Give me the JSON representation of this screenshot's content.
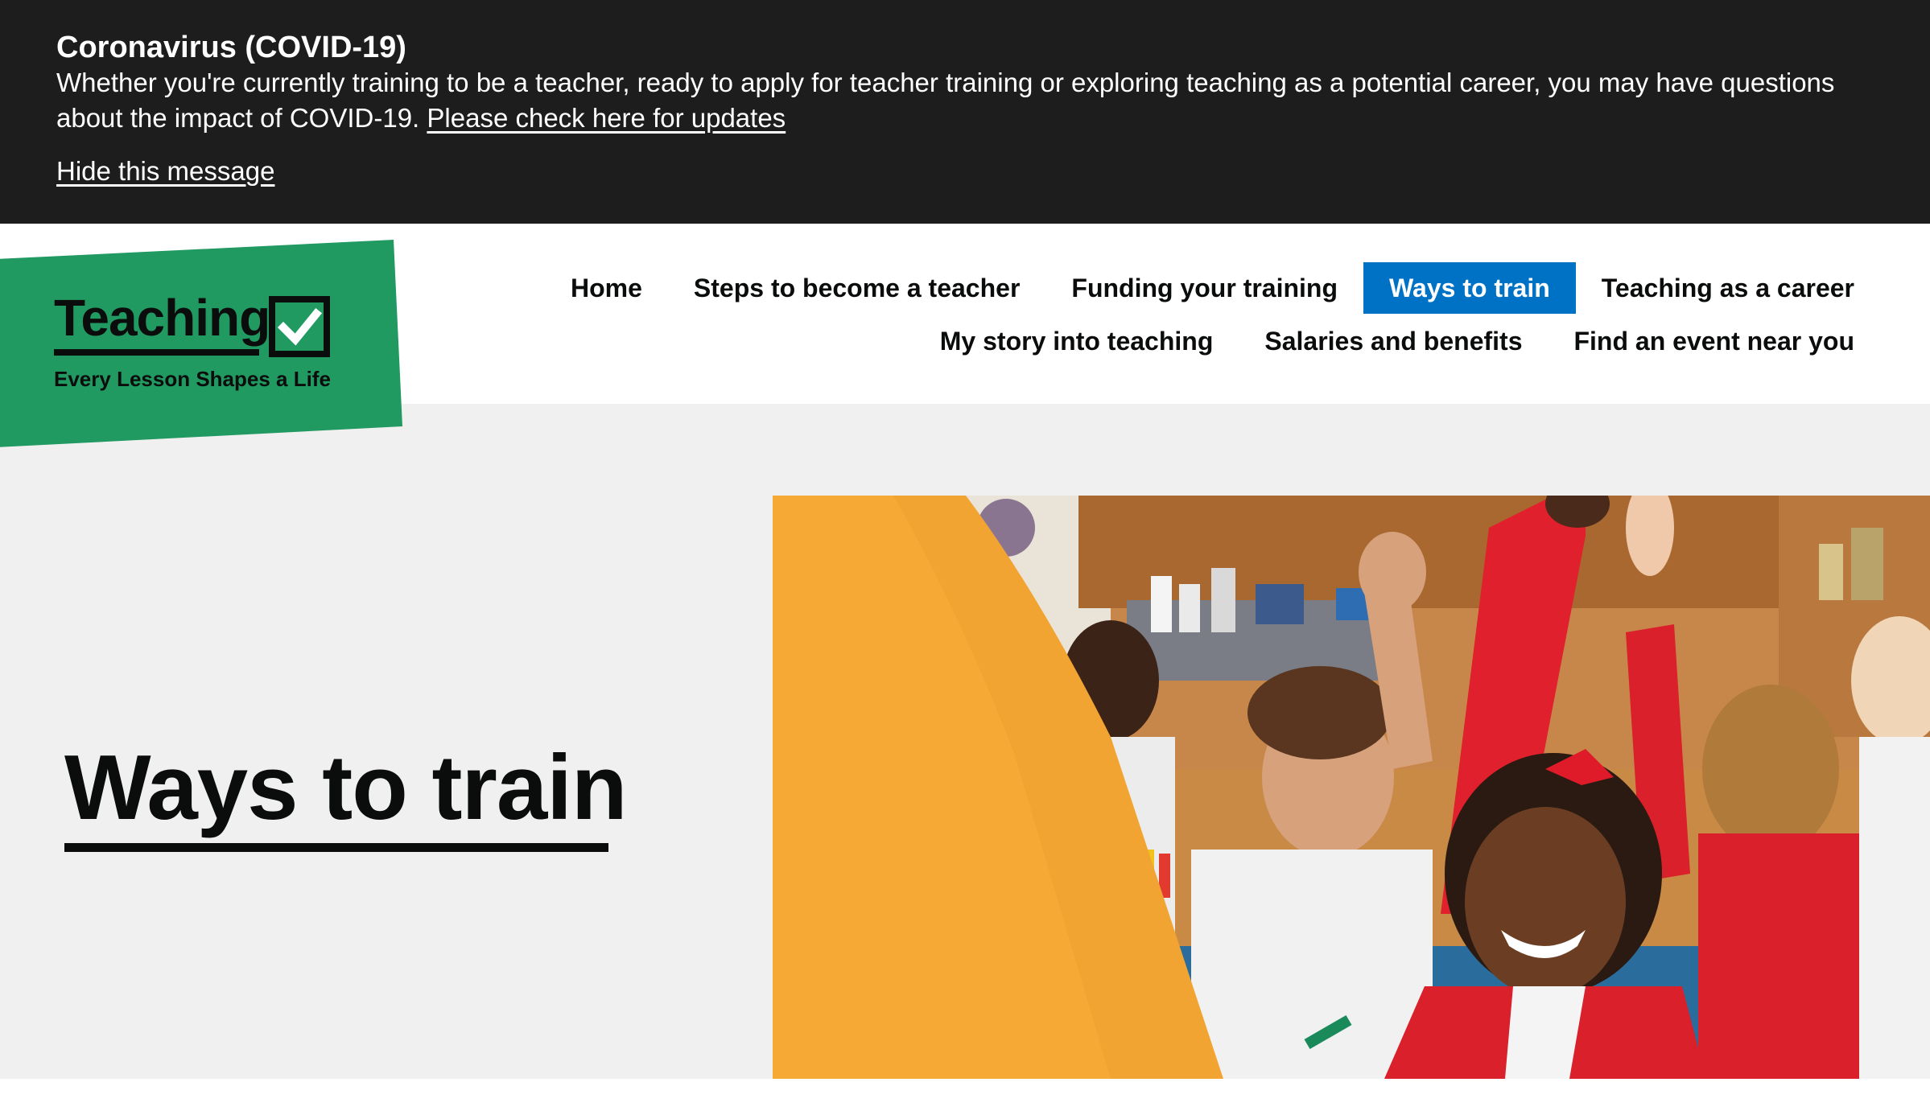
{
  "covid_banner": {
    "title": "Coronavirus (COVID-19)",
    "body": "Whether you're currently training to be a teacher, ready to apply for teacher training or exploring teaching as a potential career, you may have questions about the impact of COVID-19.",
    "updates_link": "Please check here for updates",
    "hide_link": "Hide this message"
  },
  "logo": {
    "wordmark": "Teaching",
    "tagline": "Every Lesson Shapes a Life",
    "icon": "checkbox-tick-icon",
    "brand_color": "#219a62"
  },
  "nav": {
    "row1": [
      {
        "label": "Home"
      },
      {
        "label": "Steps to become a teacher"
      },
      {
        "label": "Funding your training"
      },
      {
        "label": "Ways to train",
        "active": true
      },
      {
        "label": "Teaching as a career"
      }
    ],
    "row2": [
      {
        "label": "My story into teaching"
      },
      {
        "label": "Salaries and benefits"
      },
      {
        "label": "Find an event near you"
      }
    ],
    "active_color": "#0072c6"
  },
  "hero": {
    "title": "Ways to train",
    "image_subject": "classroom-children-raising-hands"
  }
}
